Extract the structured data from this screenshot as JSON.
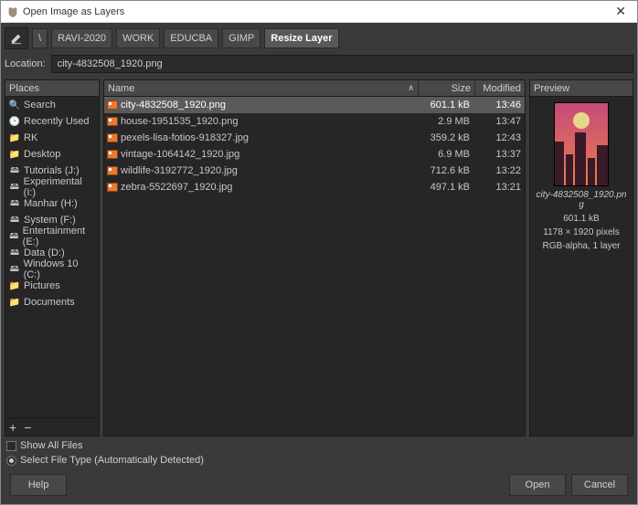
{
  "window": {
    "title": "Open Image as Layers"
  },
  "breadcrumbs": [
    "\\",
    "RAVI-2020",
    "WORK",
    "EDUCBA",
    "GIMP",
    "Resize Layer"
  ],
  "location": {
    "label": "Location:",
    "value": "city-4832508_1920.png"
  },
  "places": {
    "header": "Places",
    "items": [
      {
        "icon": "search",
        "label": "Search"
      },
      {
        "icon": "recent",
        "label": "Recently Used"
      },
      {
        "icon": "folder",
        "label": "RK"
      },
      {
        "icon": "folder",
        "label": "Desktop"
      },
      {
        "icon": "drive",
        "label": "Tutorials (J:)"
      },
      {
        "icon": "drive",
        "label": "Experimental (I:)"
      },
      {
        "icon": "drive",
        "label": "Manhar (H:)"
      },
      {
        "icon": "drive",
        "label": "System (F:)"
      },
      {
        "icon": "drive",
        "label": "Entertainment (E:)"
      },
      {
        "icon": "drive",
        "label": "Data (D:)"
      },
      {
        "icon": "drive",
        "label": "Windows 10 (C:)"
      },
      {
        "icon": "folder",
        "label": "Pictures"
      },
      {
        "icon": "folder",
        "label": "Documents"
      }
    ],
    "add": "+",
    "remove": "−"
  },
  "files": {
    "columns": {
      "name": "Name",
      "size": "Size",
      "modified": "Modified"
    },
    "rows": [
      {
        "name": "city-4832508_1920.png",
        "size": "601.1 kB",
        "modified": "13:46",
        "selected": true
      },
      {
        "name": "house-1951535_1920.png",
        "size": "2.9 MB",
        "modified": "13:47",
        "selected": false
      },
      {
        "name": "pexels-lisa-fotios-918327.jpg",
        "size": "359.2 kB",
        "modified": "12:43",
        "selected": false
      },
      {
        "name": "vintage-1064142_1920.jpg",
        "size": "6.9 MB",
        "modified": "13:37",
        "selected": false
      },
      {
        "name": "wildlife-3192772_1920.jpg",
        "size": "712.6 kB",
        "modified": "13:22",
        "selected": false
      },
      {
        "name": "zebra-5522697_1920.jpg",
        "size": "497.1 kB",
        "modified": "13:21",
        "selected": false
      }
    ]
  },
  "preview": {
    "header": "Preview",
    "filename": "city-4832508_1920.png",
    "size": "601.1 kB",
    "dimensions": "1178 × 1920 pixels",
    "mode": "RGB-alpha, 1 layer"
  },
  "options": {
    "show_all": "Show All Files",
    "filetype": "Select File Type (Automatically Detected)"
  },
  "buttons": {
    "help": "Help",
    "open": "Open",
    "cancel": "Cancel"
  }
}
